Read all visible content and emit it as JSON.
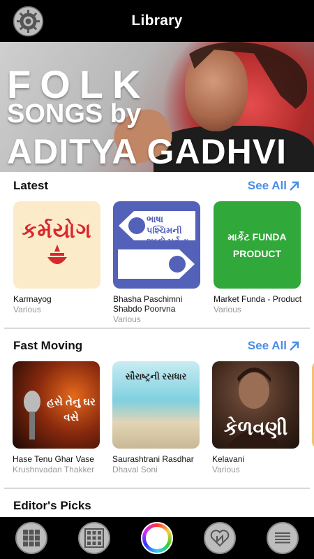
{
  "header": {
    "title": "Library"
  },
  "banner": {
    "line1": "FOLK",
    "line2": "SONGS by",
    "line3": "ADITYA GADHVI"
  },
  "sections": [
    {
      "title": "Latest",
      "see_all": "See All",
      "items": [
        {
          "name": "Karmayog",
          "author": "Various",
          "art_text": "કર્મયોગ"
        },
        {
          "name": "Bhasha Paschimni Shabdo Poorvna",
          "author": "Various",
          "art_text": "ભાષા પશ્ચિમની શબ્દો પૂર્વના"
        },
        {
          "name": "Market Funda - Product",
          "author": "Various",
          "art_text": "માર્કેટ FUNDA PRODUCT"
        }
      ]
    },
    {
      "title": "Fast Moving",
      "see_all": "See All",
      "items": [
        {
          "name": "Hase Tenu Ghar Vase",
          "author": "Krushnvadan Thakker",
          "art_text": "હસે તેનુ ઘર વસે"
        },
        {
          "name": "Saurashtrani Rasdhar",
          "author": "Dhaval Soni",
          "art_text": "સૌરાષ્ટ્રની રસધાર"
        },
        {
          "name": "Kelavani",
          "author": "Various",
          "art_text": "કેળવણી"
        }
      ]
    },
    {
      "title": "Editor's Picks"
    }
  ],
  "bottom_nav": [
    "grid-icon",
    "grid-alt-icon",
    "color-wheel-icon",
    "heart-icon",
    "menu-lines-icon"
  ]
}
